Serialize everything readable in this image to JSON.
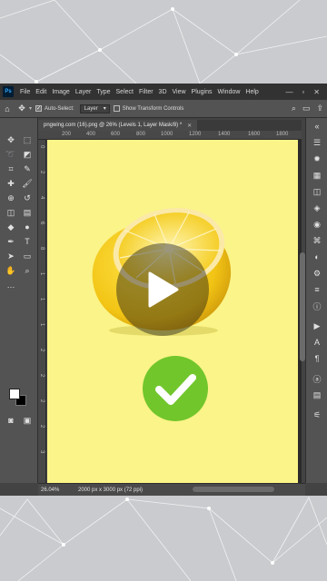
{
  "menubar": {
    "logo": "Ps",
    "items": [
      "File",
      "Edit",
      "Image",
      "Layer",
      "Type",
      "Select",
      "Filter",
      "3D",
      "View",
      "Plugins",
      "Window",
      "Help"
    ],
    "controls": [
      "—",
      "▫",
      "✕"
    ]
  },
  "options": {
    "auto_select_label": "Auto-Select:",
    "auto_select_checked": true,
    "target_value": "Layer",
    "transform_label": "Show Transform Controls",
    "transform_checked": false
  },
  "document": {
    "tab_title": "pngwing.com (16).png @ 26% (Levels 1, Layer Mask/8) *",
    "tab_close": "✕",
    "ruler_h": [
      "200",
      "400",
      "600",
      "800",
      "1000",
      "1200",
      "1400",
      "1600",
      "1800"
    ],
    "ruler_v": [
      "0",
      "2",
      "4",
      "6",
      "8",
      "1",
      "1",
      "1",
      "2",
      "2",
      "2",
      "2",
      "3"
    ]
  },
  "status": {
    "zoom": "26.04%",
    "info": "2000 px x 3000 px (72 ppi)"
  },
  "colors": {
    "canvas": "#fbf488",
    "check_green": "#71c62c",
    "ui_panel": "#535353",
    "ui_dark": "#323232"
  },
  "icons": {
    "left_tools": [
      "move-tool-icon",
      "marquee-tool-icon",
      "lasso-tool-icon",
      "object-select-icon",
      "crop-tool-icon",
      "eyedropper-icon",
      "healing-brush-icon",
      "brush-tool-icon",
      "clone-stamp-icon",
      "history-brush-icon",
      "eraser-icon",
      "gradient-icon",
      "blur-icon",
      "dodge-icon",
      "pen-tool-icon",
      "type-tool-icon",
      "path-select-icon",
      "shape-tool-icon",
      "hand-tool-icon",
      "zoom-tool-icon"
    ],
    "right_panels": [
      "history-panel-icon",
      "color-panel-icon",
      "swatches-panel-icon",
      "libraries-panel-icon",
      "layers-panel-icon",
      "channels-panel-icon",
      "paths-panel-icon",
      "adjustments-panel-icon",
      "properties-panel-icon",
      "character-panel-icon",
      "paragraph-panel-icon",
      "glyphs-panel-icon",
      "info-panel-icon"
    ]
  }
}
